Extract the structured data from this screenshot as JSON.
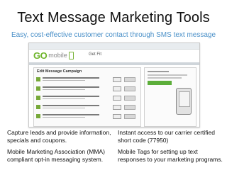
{
  "slide": {
    "title": "Text Message Marketing Tools",
    "subtitle": "Easy, cost-effective customer contact through SMS text message"
  },
  "screenshot": {
    "logo": "GO",
    "logo_suffix": "mobile",
    "tagline": "Get Fit",
    "panel_title": "Edit Message Campaign"
  },
  "features": {
    "left_col": [
      "Capture leads and provide information, specials and coupons.",
      "Mobile Marketing Association (MMA) compliant opt-in messaging system."
    ],
    "right_col": [
      "Instant access to our carrier certified short code (77950)",
      "Mobile Tags for setting up text responses to your marketing programs."
    ]
  }
}
